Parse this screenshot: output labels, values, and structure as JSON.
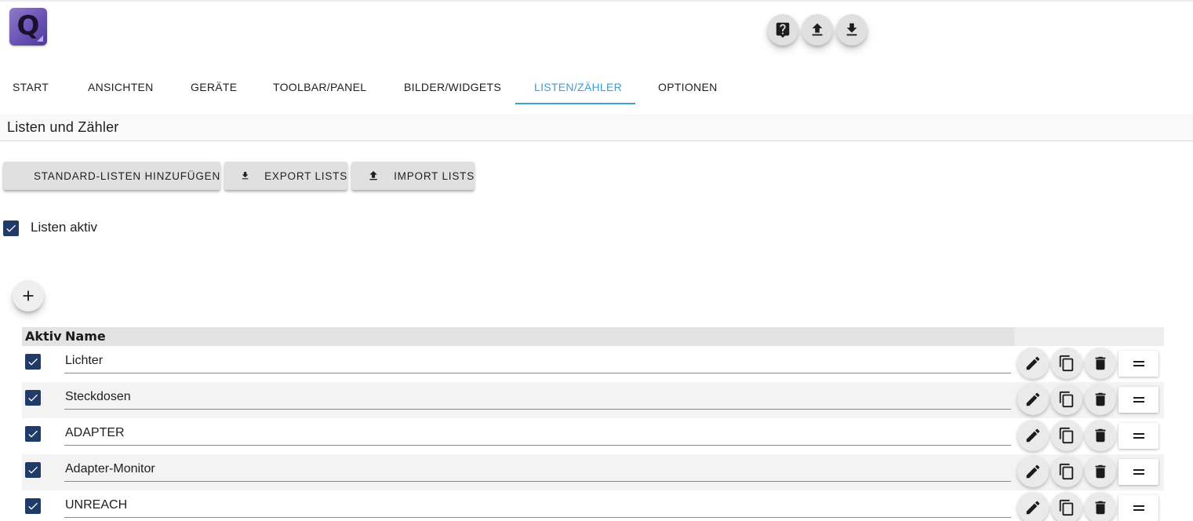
{
  "app": {
    "logo_letter": "Q"
  },
  "header_icons": [
    "help-icon",
    "upload-icon",
    "download-icon"
  ],
  "tabs": [
    {
      "label": "START"
    },
    {
      "label": "ANSICHTEN"
    },
    {
      "label": "GERÄTE"
    },
    {
      "label": "TOOLBAR/PANEL"
    },
    {
      "label": "BILDER/WIDGETS"
    },
    {
      "label": "LISTEN/ZÄHLER",
      "active": true
    },
    {
      "label": "OPTIONEN"
    }
  ],
  "section": {
    "title": "Listen und Zähler"
  },
  "actions": {
    "add_default": {
      "label": "STANDARD-LISTEN HINZUFÜGEN",
      "icon": "scatter-dots-icon"
    },
    "export": {
      "label": "EXPORT LISTS",
      "icon": "download-icon"
    },
    "import": {
      "label": "IMPORT LISTS",
      "icon": "upload-icon"
    }
  },
  "lists_active": {
    "label": "Listen aktiv",
    "checked": true
  },
  "table": {
    "headers": {
      "active": "Aktiv",
      "name": "Name"
    },
    "rows": [
      {
        "active": true,
        "name": "Lichter"
      },
      {
        "active": true,
        "name": "Steckdosen"
      },
      {
        "active": true,
        "name": "ADAPTER"
      },
      {
        "active": true,
        "name": "Adapter-Monitor"
      },
      {
        "active": true,
        "name": "UNREACH"
      }
    ],
    "row_actions": [
      "edit-icon",
      "copy-icon",
      "delete-icon",
      "drag-handle-icon"
    ]
  },
  "colors": {
    "accent": "#3b9fd1",
    "checkbox": "#1f3b66",
    "button_bg": "#e0e0e0"
  }
}
